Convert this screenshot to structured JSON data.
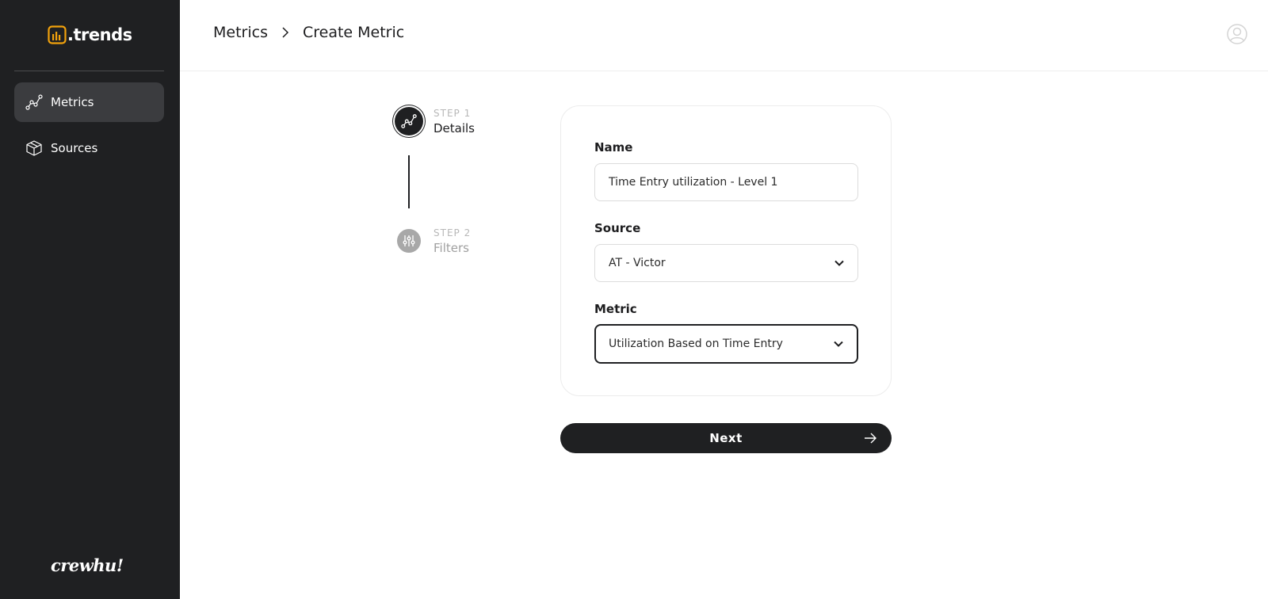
{
  "app": {
    "logo_text": ".trends",
    "footer_brand": "crewhu!"
  },
  "sidebar": {
    "items": [
      {
        "label": "Metrics",
        "icon": "metrics-line-icon",
        "active": true
      },
      {
        "label": "Sources",
        "icon": "box-icon",
        "active": false
      }
    ]
  },
  "header": {
    "breadcrumb": [
      "Metrics",
      "Create Metric"
    ],
    "avatar_icon": "user-circle-icon"
  },
  "stepper": {
    "steps": [
      {
        "number": "STEP 1",
        "title": "Details",
        "state": "active",
        "icon": "metrics-line-icon"
      },
      {
        "number": "STEP 2",
        "title": "Filters",
        "state": "inactive",
        "icon": "sliders-icon"
      }
    ]
  },
  "form": {
    "name": {
      "label": "Name",
      "value": "Time Entry utilization - Level 1"
    },
    "source": {
      "label": "Source",
      "value": "AT - Victor"
    },
    "metric": {
      "label": "Metric",
      "value": "Utilization Based on Time Entry"
    }
  },
  "actions": {
    "next_label": "Next"
  },
  "colors": {
    "sidebar_bg": "#1f2022",
    "accent": "#f2a20c",
    "primary_button": "#1f2022"
  }
}
